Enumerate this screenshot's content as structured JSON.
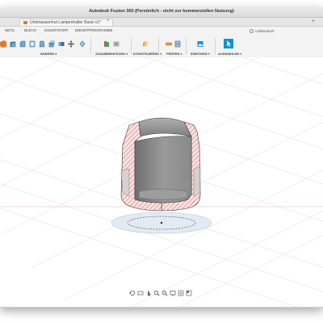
{
  "window": {
    "title": "Autodesk Fusion 360 (Persönlich - nicht zur kommerziellen Nutzung)"
  },
  "document_tab": {
    "label": "Untertassenhut Lampenhalter Basis v1*",
    "close": "×"
  },
  "user": {
    "name": "Unbenannt*"
  },
  "toolbar": {
    "tabs": [
      "NETZ",
      "BLECH",
      "KUNSTSTOFF",
      "DIENSTPROGRAMME"
    ],
    "groups": {
      "modify": "ÄNDERN ▾",
      "assemble": "ZUSAMMENFÜGEN ▾",
      "construct": "KONSTRUIEREN ▾",
      "inspect": "PRÜFEN ▾",
      "insert": "EINFÜGEN ▾",
      "select": "AUSWÄHLEN ▾"
    }
  },
  "colors": {
    "accent": "#0696d7",
    "section_hatch": "#d94c4c",
    "section_fill": "#f6dede",
    "part_gray": "#8a8a8a",
    "toolbar_bg": "#f3f3f3"
  },
  "icons": {
    "fillet": "fillet-icon",
    "move": "move-icon",
    "joint": "joint-icon",
    "plane": "offset-plane-icon",
    "measure": "measure-icon",
    "insert": "insert-image-icon",
    "select": "select-arrow-icon"
  }
}
